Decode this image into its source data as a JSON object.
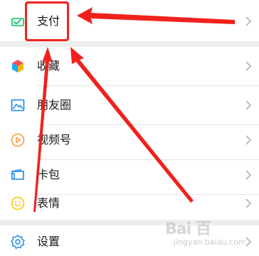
{
  "menu": {
    "pay": {
      "label": "支付",
      "icon": "wechat-pay-icon"
    },
    "items": [
      {
        "label": "收藏",
        "icon": "favorites-cube-icon"
      },
      {
        "label": "朋友圈",
        "icon": "moments-photo-icon"
      },
      {
        "label": "视频号",
        "icon": "channels-play-icon"
      },
      {
        "label": "卡包",
        "icon": "card-wallet-icon"
      },
      {
        "label": "表情",
        "icon": "emoji-smile-icon"
      }
    ],
    "settings": {
      "label": "设置",
      "icon": "settings-gear-icon"
    }
  },
  "annotation": {
    "highlight_color": "#f0211c"
  },
  "watermark": {
    "brand": "Bai 百",
    "sub": "jingyan.baidu.com"
  },
  "colors": {
    "background": "#ededed",
    "row": "#ffffff",
    "pay_green": "#07c160",
    "favorites_orange": "#f7b500",
    "favorites_red": "#fa5151",
    "favorites_blue": "#10aeff",
    "moments_blue": "#1485ee",
    "channels_orange": "#fa9d3b",
    "card_blue": "#1485ee",
    "emoji_yellow": "#ffc300",
    "settings_blue": "#1485ee"
  }
}
